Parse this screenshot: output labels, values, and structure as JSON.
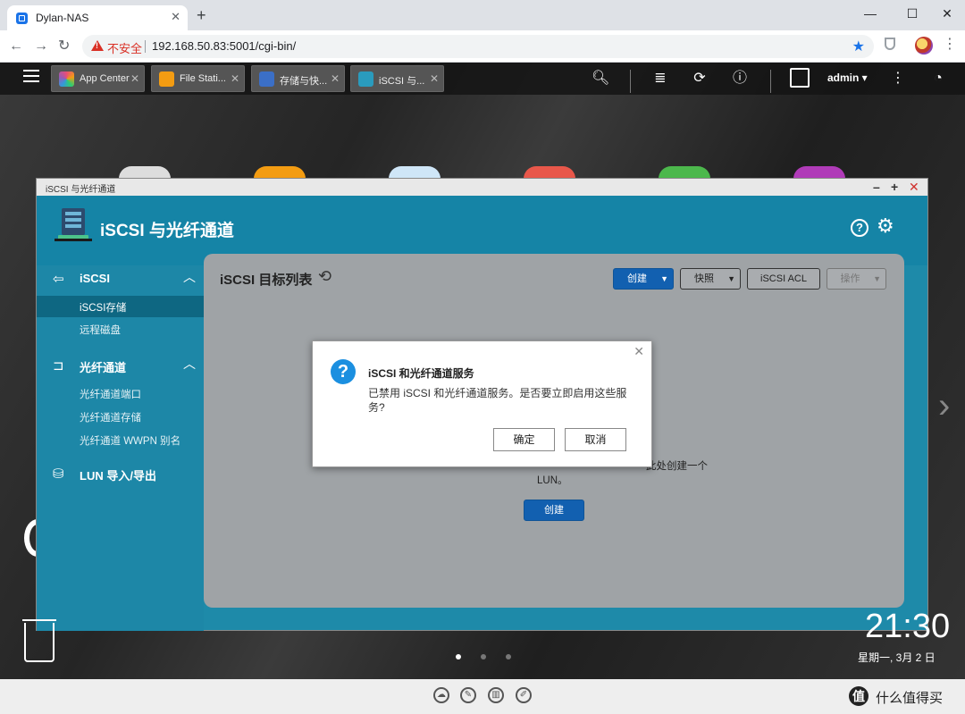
{
  "browser": {
    "tab_title": "Dylan-NAS",
    "new_tab": "+",
    "insecure_label": "不安全",
    "url": "192.168.50.83:5001/cgi-bin/"
  },
  "qts_bar": {
    "tabs": [
      {
        "label": "App Center",
        "color": "#e94e77"
      },
      {
        "label": "File Stati...",
        "color": "#f39c12"
      },
      {
        "label": "存储与快...",
        "color": "#3b6fc7"
      },
      {
        "label": "iSCSI 与...",
        "color": "#2a9bbd"
      }
    ],
    "user": "admin ▾"
  },
  "window": {
    "titlebar": "iSCSI 与光纤通道",
    "title": "iSCSI 与光纤通道"
  },
  "sidebar": {
    "sec_iscsi": "iSCSI",
    "iscsi_storage": "iSCSI存储",
    "remote_disk": "远程磁盘",
    "sec_fc": "光纤通道",
    "fc_ports": "光纤通道端口",
    "fc_storage": "光纤通道存储",
    "fc_wwpn": "光纤通道 WWPN 别名",
    "sec_lun": "LUN 导入/导出"
  },
  "main": {
    "title": "iSCSI 目标列表",
    "btn_create": "创建",
    "btn_snapshot": "快照",
    "btn_acl": "iSCSI ACL",
    "btn_action": "操作",
    "hint_line1": "此处创建一个",
    "hint_line2": "LUN。",
    "btn_create_empty": "创建"
  },
  "dialog": {
    "title": "iSCSI 和光纤通道服务",
    "message": "已禁用 iSCSI 和光纤通道服务。是否要立即启用这些服务?",
    "ok": "确定",
    "cancel": "取消"
  },
  "desktop": {
    "clock": "21:30",
    "date": "星期一, 3月 2 日"
  },
  "footer": {
    "watermark": "什么值得买",
    "logo_glyph": "值"
  }
}
